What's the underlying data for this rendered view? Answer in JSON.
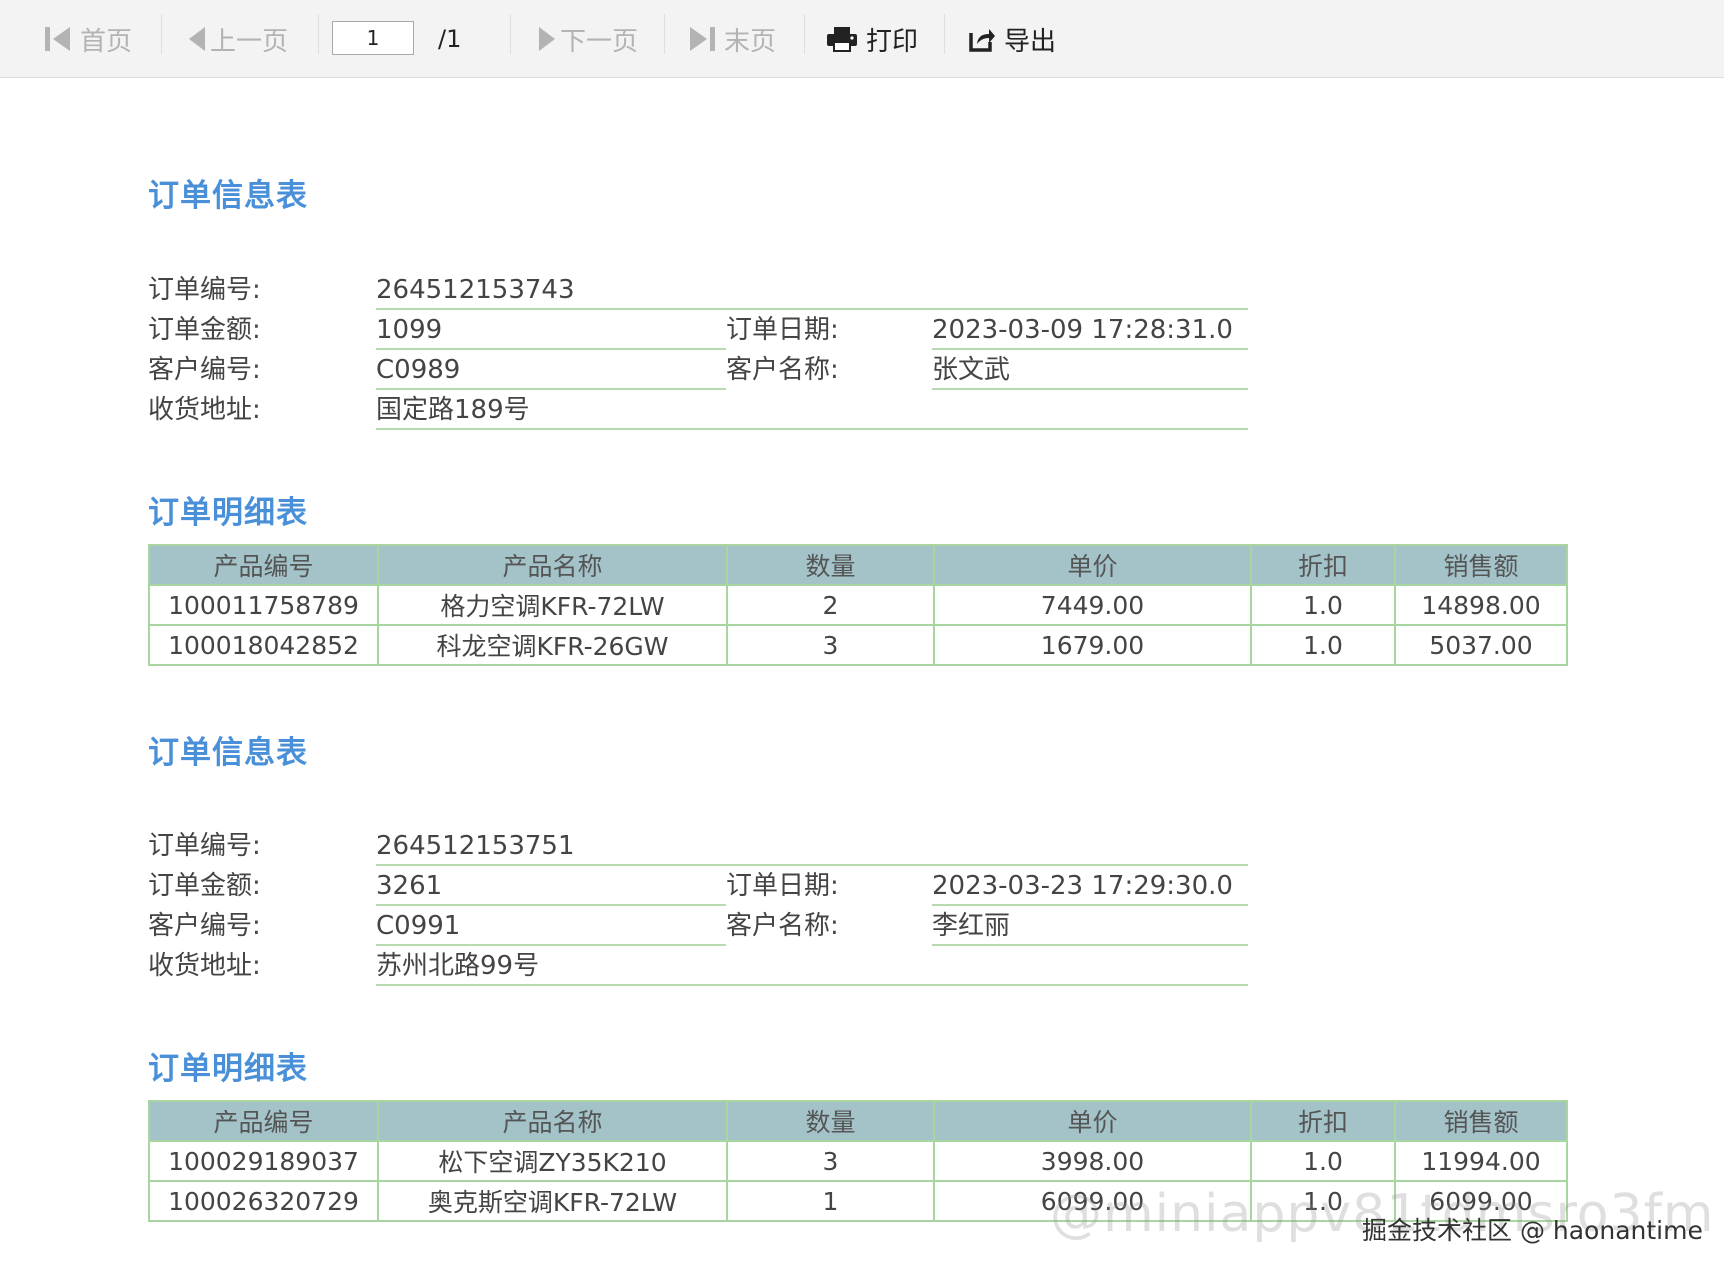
{
  "toolbar": {
    "first_label": "首页",
    "prev_label": "上一页",
    "current_page": "1",
    "total_pages": "/1",
    "next_label": "下一页",
    "last_label": "末页",
    "print_label": "打印",
    "export_label": "导出"
  },
  "orders": [
    {
      "info_title": "订单信息表",
      "order_no_label": "订单编号:",
      "order_no": "264512153743",
      "amount_label": "订单金额:",
      "amount": "1099",
      "date_label": "订单日期:",
      "date": "2023-03-09 17:28:31.0",
      "customer_no_label": "客户编号:",
      "customer_no": "C0989",
      "customer_name_label": "客户名称:",
      "customer_name": "张文武",
      "address_label": "收货地址:",
      "address": "国定路189号",
      "detail_title": "订单明细表",
      "columns": [
        "产品编号",
        "产品名称",
        "数量",
        "单价",
        "折扣",
        "销售额"
      ],
      "rows": [
        [
          "100011758789",
          "格力空调KFR-72LW",
          "2",
          "7449.00",
          "1.0",
          "14898.00"
        ],
        [
          "100018042852",
          "科龙空调KFR-26GW",
          "3",
          "1679.00",
          "1.0",
          "5037.00"
        ]
      ]
    },
    {
      "info_title": "订单信息表",
      "order_no_label": "订单编号:",
      "order_no": "264512153751",
      "amount_label": "订单金额:",
      "amount": "3261",
      "date_label": "订单日期:",
      "date": "2023-03-23 17:29:30.0",
      "customer_no_label": "客户编号:",
      "customer_no": "C0991",
      "customer_name_label": "客户名称:",
      "customer_name": "李红丽",
      "address_label": "收货地址:",
      "address": "苏州北路99号",
      "detail_title": "订单明细表",
      "columns": [
        "产品编号",
        "产品名称",
        "数量",
        "单价",
        "折扣",
        "销售额"
      ],
      "rows": [
        [
          "100029189037",
          "松下空调ZY35K210",
          "3",
          "3998.00",
          "1.0",
          "11994.00"
        ],
        [
          "100026320729",
          "奥克斯空调KFR-72LW",
          "1",
          "6099.00",
          "1.0",
          "6099.00"
        ]
      ]
    }
  ],
  "watermark": {
    "main": "@miniappv81tdmsro3fm",
    "sub": "掘金技术社区 @ haonantime"
  }
}
